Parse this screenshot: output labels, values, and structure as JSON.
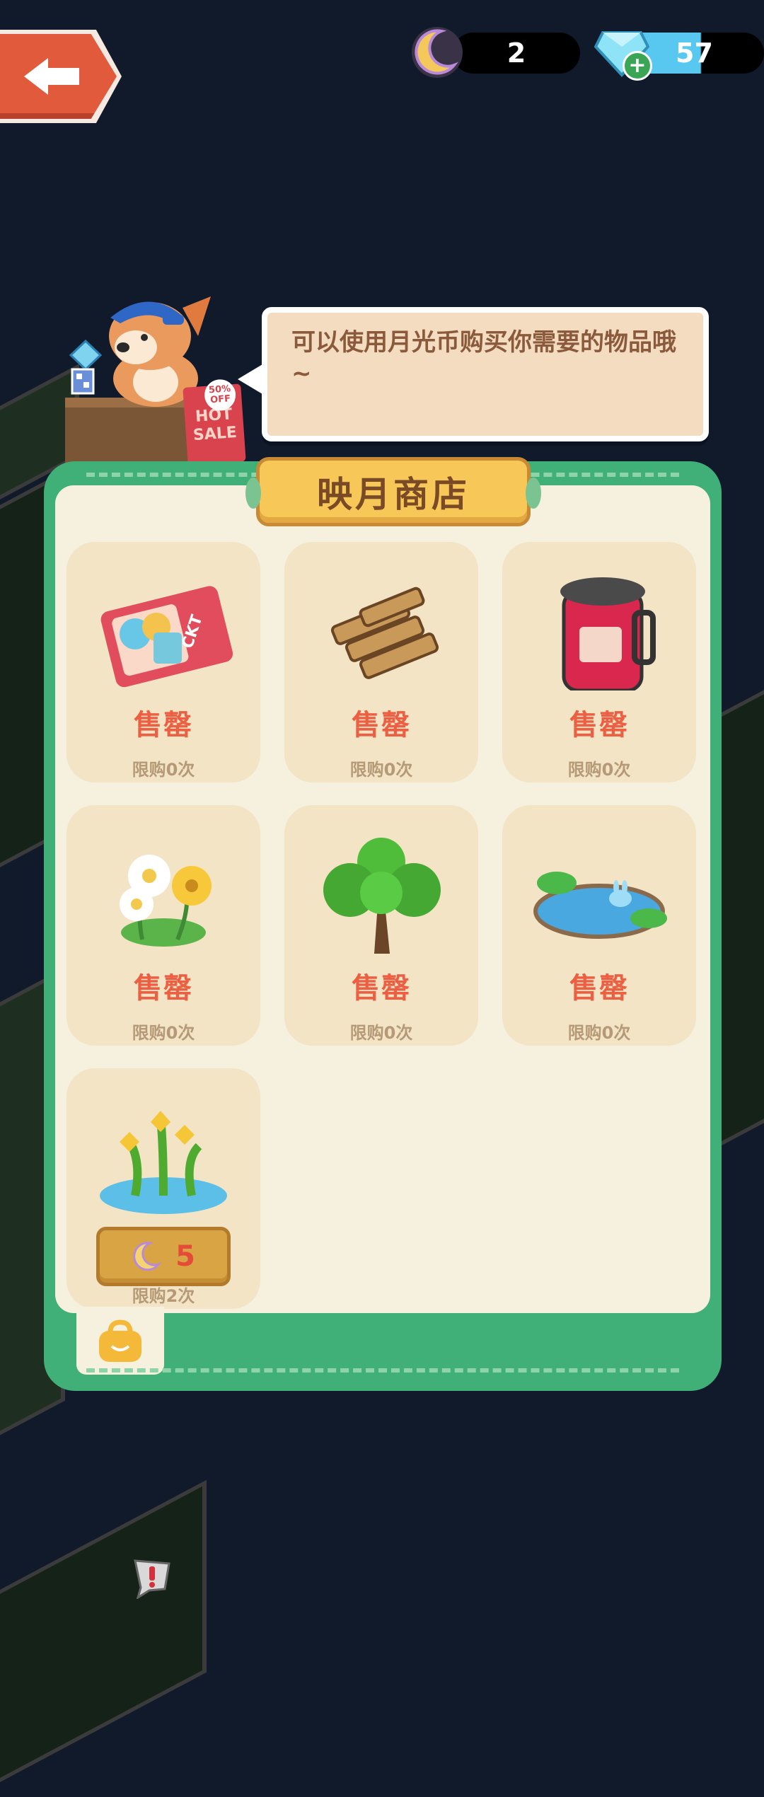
{
  "top_bar": {
    "moon_coins": "2",
    "gems": "57",
    "back_icon": "left-arrow-icon",
    "gem_add_icon": "plus-icon"
  },
  "npc": {
    "speech": "可以使用月光币购买你需要的物品哦~",
    "sign_badge": "50% OFF",
    "sign_text_1": "HOT",
    "sign_text_2": "SALE"
  },
  "shop": {
    "title": "映月商店",
    "items": [
      {
        "icon": "ticket-icon",
        "status": "售罄",
        "limit": "限购0次"
      },
      {
        "icon": "wood-logs-icon",
        "status": "售罄",
        "limit": "限购0次"
      },
      {
        "icon": "jam-jar-icon",
        "status": "售罄",
        "limit": "限购0次"
      },
      {
        "icon": "daisy-flowers-icon",
        "status": "售罄",
        "limit": "限购0次"
      },
      {
        "icon": "tree-icon",
        "status": "售罄",
        "limit": "限购0次"
      },
      {
        "icon": "pond-icon",
        "status": "售罄",
        "limit": "限购0次"
      },
      {
        "icon": "yellow-lily-pond-icon",
        "price": "5",
        "limit": "限购2次"
      }
    ],
    "bag_icon": "bag-icon"
  },
  "colors": {
    "panel_green": "#41b078",
    "sold_out_red": "#ed5f43",
    "title_gold": "#f7c857"
  }
}
